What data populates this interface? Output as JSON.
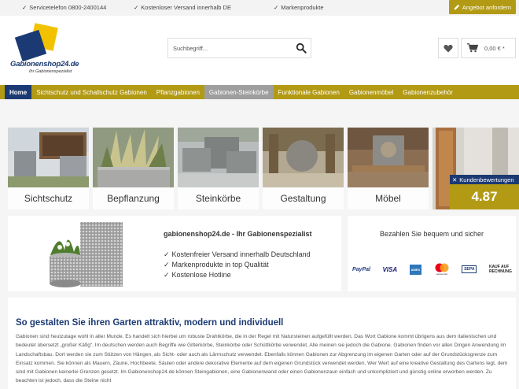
{
  "topbar": {
    "items": [
      "Servicetelefon 0800-2400144",
      "Kostenloser Versand innerhalb DE",
      "Markenprodukte"
    ],
    "offer_button": "Angebot anfordern"
  },
  "logo": {
    "name": "Gabionenshop24.de",
    "tagline": "Ihr Gabionenspezialist"
  },
  "search": {
    "placeholder": "Suchbegriff..."
  },
  "cart": {
    "total": "0,00 € *"
  },
  "nav": {
    "items": [
      "Home",
      "Sichtschutz und Schallschutz Gabionen",
      "Pflanzgabionen",
      "Gabionen-Steinkörbe",
      "Funktionale Gabionen",
      "Gabionenmöbel",
      "Gabionenzubehör"
    ]
  },
  "categories": [
    "Sichtschutz",
    "Bepflanzung",
    "Steinkörbe",
    "Gestaltung",
    "Möbel"
  ],
  "reviews": {
    "label": "Kundenbewertungen",
    "score": "4.87"
  },
  "info": {
    "title": "gabionenshop24.de - Ihr Gabionenspezialist",
    "features": [
      "Kostenfreier Versand innerhalb Deutschland",
      "Markenprodukte in top Qualität",
      "Kostenlose Hotline"
    ]
  },
  "payment": {
    "title": "Bezahlen Sie bequem und sicher",
    "methods": [
      "PayPal",
      "VISA",
      "AMEX",
      "mastercard",
      "SEPA",
      "KAUF AUF RECHNUNG"
    ]
  },
  "content": {
    "heading": "So gestalten Sie ihren Garten attraktiv, modern und individuell",
    "body": "Gabionen sind heutzutage wohl in aller Munde. Es handelt sich hierbei um robuste Drahtkörbe, die in der Regel mit Natursteinen aufgefüllt werden. Das Wort Gabione kommt übrigens aus dem italienischen und bedeutet übersetzt „großer Käfig“. Im deutschen werden auch Begriffe wie Gitterkörbe, Steinkörbe oder Schüttkörbe verwendet. Alle meinen sie jedoch die Gabione. Gabionen finden vor allen Dingen Anwendung im Landschaftsbau. Dort werden sie zum Stützen von Hängen, als Sicht- oder auch als Lärmschutz verwendet. Ebenfalls können Gabionen zur Abgrenzung im eigenen Garten oder auf der Grundstücksgrenze zum Einsatz kommen. Sie können als Mauern, Zäune, Hochbeete, Säulen oder andere dekorative Elemente auf dem eigenen Grundstück verwendet werden. Wer Wert auf eine kreative Gestaltung des Gartens legt, dem sind mit Gabionen keinerlei Grenzen gesetzt. Im Gabionenshop24.de können Steingabionen, eine Gabionenwand oder einen Gabionenzaun einfach und unkompliziert und günstig online erworben werden. Zu beachten ist jedoch, dass die Steine nicht"
  },
  "colors": {
    "brand_gold": "#b39a14",
    "brand_navy": "#1b3a73"
  }
}
